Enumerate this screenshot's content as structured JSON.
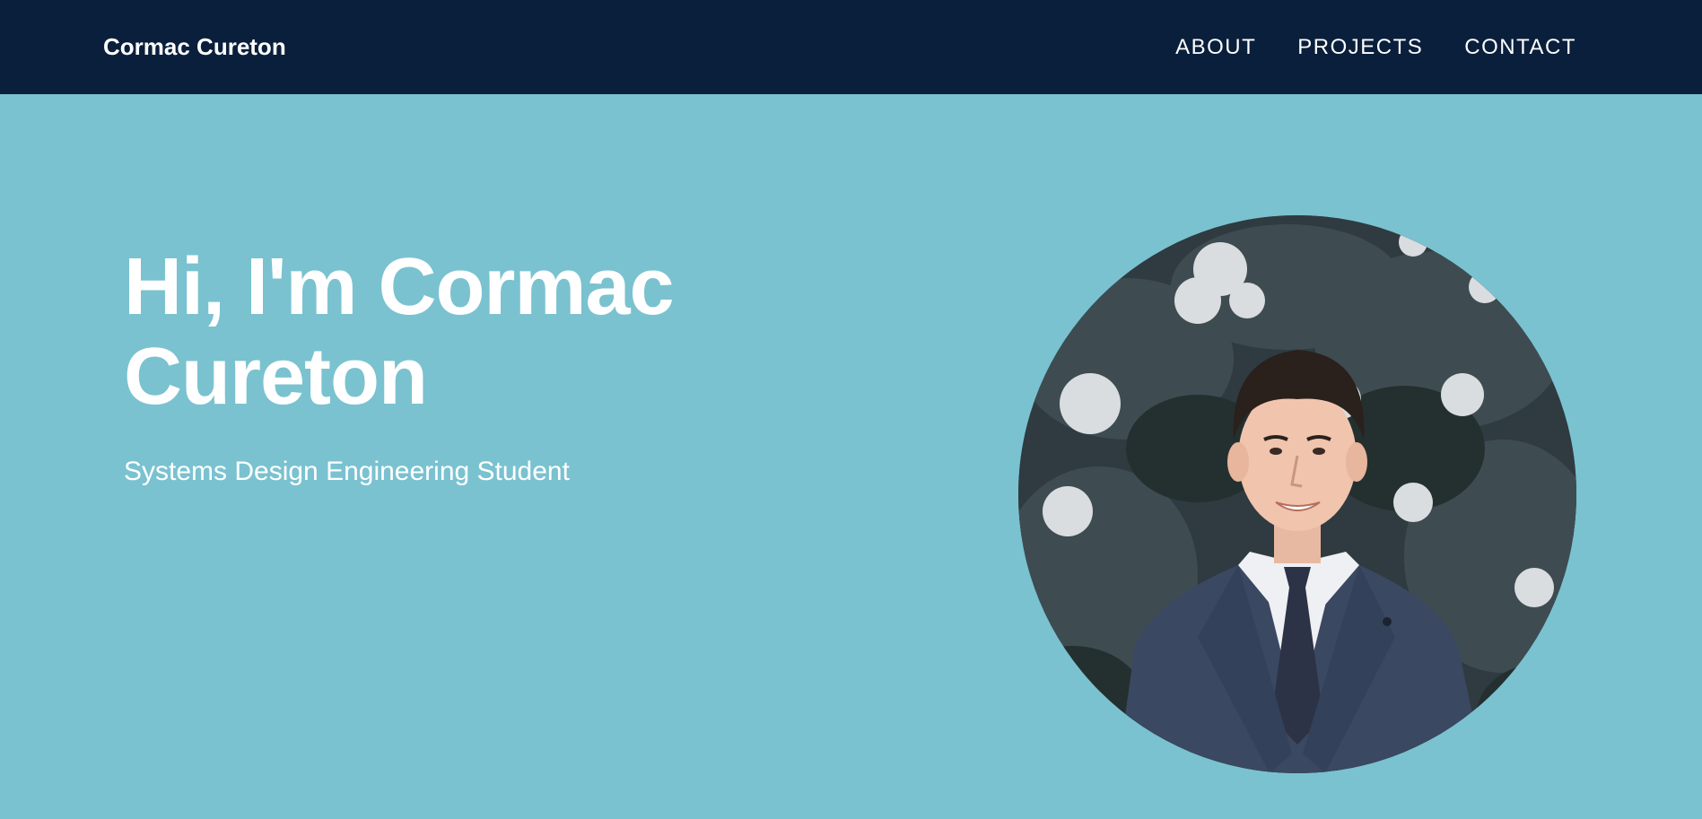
{
  "navbar": {
    "brand": "Cormac Cureton",
    "links": [
      {
        "label": "ABOUT"
      },
      {
        "label": "PROJECTS"
      },
      {
        "label": "CONTACT"
      }
    ]
  },
  "hero": {
    "title_line1": "Hi, I'm Cormac",
    "title_line2": "Cureton",
    "subtitle": "Systems Design Engineering Student"
  },
  "colors": {
    "navbar_bg": "#0a1f3b",
    "hero_bg": "#7ac2d0",
    "text": "#ffffff"
  }
}
